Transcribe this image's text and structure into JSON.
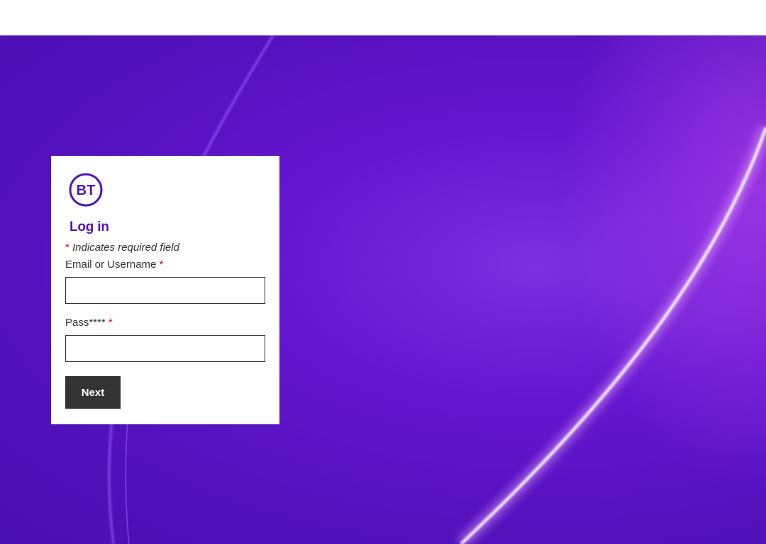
{
  "colors": {
    "brand_purple": "#5514b4",
    "background_purple": "#6416cf",
    "required_red": "#e60014",
    "button_dark": "#333333"
  },
  "brand": {
    "logo_text": "BT",
    "logo_icon": "bt-logo-icon"
  },
  "login": {
    "title": "Log in",
    "required_asterisk": "*",
    "required_note": " Indicates required field",
    "email_label": "Email or Username ",
    "password_label": "Pass**** ",
    "email_value": "",
    "password_value": "",
    "next_label": "Next"
  }
}
